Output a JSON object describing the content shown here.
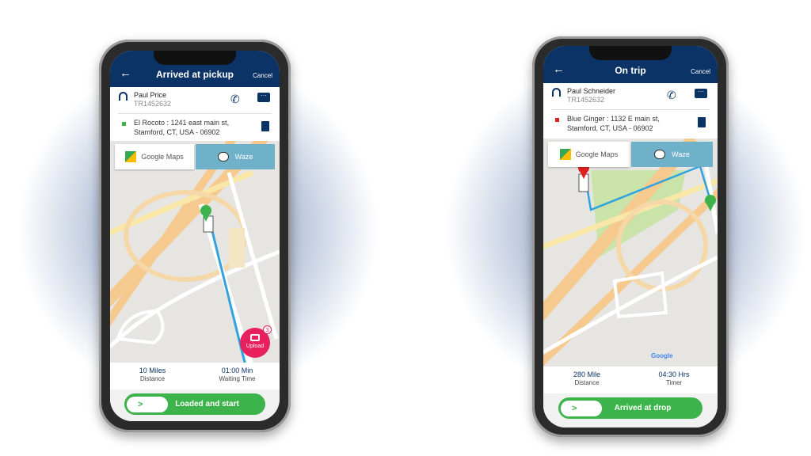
{
  "phones": [
    {
      "header": {
        "title": "Arrived at pickup",
        "cancel": "Cancel"
      },
      "customer": {
        "name": "Paul Price",
        "id": "TR1452632"
      },
      "address": {
        "line1": "El Rocoto : 1241 east main st,",
        "line2": "Stamford, CT, USA - 06902",
        "marker_color": "#3cb44b"
      },
      "nav": {
        "google": "Google Maps",
        "waze": "Waze"
      },
      "stats": [
        {
          "value": "10 Miles",
          "label": "Distance"
        },
        {
          "value": "01:00 Min",
          "label": "Waiting Time"
        }
      ],
      "upload": {
        "label": "Upload",
        "count": "3"
      },
      "action": {
        "label": "Loaded and start",
        "knob": ">"
      }
    },
    {
      "header": {
        "title": "On trip",
        "cancel": "Cancel"
      },
      "customer": {
        "name": "Paul Schneider",
        "id": "TR1452632"
      },
      "address": {
        "line1": "Blue Ginger : 1132 E main st,",
        "line2": "Stamford, CT, USA - 06902",
        "marker_color": "#e02020"
      },
      "nav": {
        "google": "Google Maps",
        "waze": "Waze"
      },
      "stats": [
        {
          "value": "280 Mile",
          "label": "Distance"
        },
        {
          "value": "04:30 Hrs",
          "label": "Timer"
        }
      ],
      "map": {
        "logo": "Google"
      },
      "action": {
        "label": "Arrived at drop",
        "knob": ">"
      }
    }
  ],
  "colors": {
    "header": "#0b3366",
    "action": "#3cb44b",
    "route": "#2fa3e0",
    "upload": "#e8205e"
  }
}
